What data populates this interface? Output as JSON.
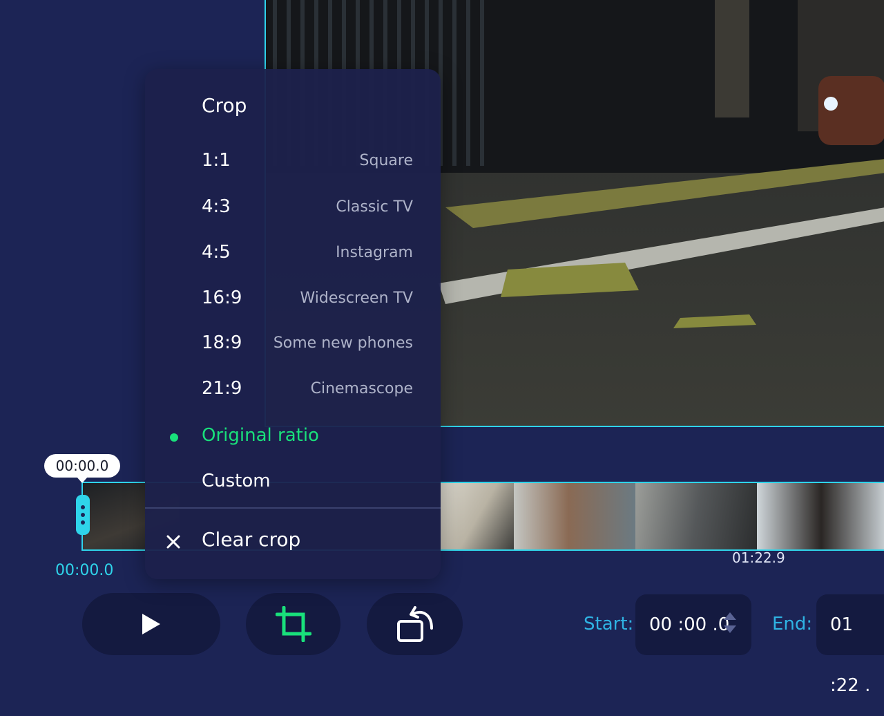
{
  "crop_menu": {
    "title": "Crop",
    "options": [
      {
        "ratio": "1:1",
        "desc": "Square"
      },
      {
        "ratio": "4:3",
        "desc": "Classic TV"
      },
      {
        "ratio": "4:5",
        "desc": "Instagram"
      },
      {
        "ratio": "16:9",
        "desc": "Widescreen TV"
      },
      {
        "ratio": "18:9",
        "desc": "Some new phones"
      },
      {
        "ratio": "21:9",
        "desc": "Cinemascope"
      }
    ],
    "original": "Original ratio",
    "custom": "Custom",
    "clear": "Clear crop"
  },
  "timeline": {
    "bubble_time": "00:00.0",
    "current_time": "00:00.0",
    "end_time": "01:22.9"
  },
  "controls": {
    "start_label": "Start:",
    "start_value": "00 :00 .0",
    "end_label": "End:",
    "end_value": "01 :22 ."
  },
  "colors": {
    "accent": "#2fd4ea",
    "active": "#19e07b",
    "background": "#1c2455"
  },
  "icons": [
    "play-icon",
    "crop-icon",
    "rotate-icon",
    "close-icon",
    "spinner-up-icon",
    "spinner-down-icon"
  ]
}
